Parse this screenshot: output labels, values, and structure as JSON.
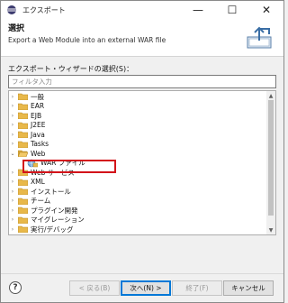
{
  "window": {
    "title": "エクスポート",
    "controls": {
      "minimize": "—",
      "maximize": "☐",
      "close": "✕"
    }
  },
  "banner": {
    "title": "選択",
    "description": "Export a Web Module into an external WAR file",
    "icon": "export-icon"
  },
  "wizard": {
    "label": "エクスポート・ウィザードの選択(S)：",
    "filter_placeholder": "フィルタ入力"
  },
  "tree": {
    "items": [
      {
        "label": "一般",
        "expanded": false
      },
      {
        "label": "EAR",
        "expanded": false
      },
      {
        "label": "EJB",
        "expanded": false
      },
      {
        "label": "J2EE",
        "expanded": false
      },
      {
        "label": "Java",
        "expanded": false
      },
      {
        "label": "Tasks",
        "expanded": false
      },
      {
        "label": "Web",
        "expanded": true
      },
      {
        "label": "WAR ファイル",
        "child": true,
        "selected": true
      },
      {
        "label": "Web サービス",
        "expanded": false
      },
      {
        "label": "XML",
        "expanded": false
      },
      {
        "label": "インストール",
        "expanded": false
      },
      {
        "label": "チーム",
        "expanded": false
      },
      {
        "label": "プラグイン開発",
        "expanded": false
      },
      {
        "label": "マイグレーション",
        "expanded": false
      },
      {
        "label": "実行/デバッグ",
        "expanded": false
      }
    ]
  },
  "buttons": {
    "help": "?",
    "back": "< 戻る(B)",
    "next": "次へ(N) >",
    "finish": "終了(F)",
    "cancel": "キャンセル"
  },
  "colors": {
    "highlight_border": "#d3141a",
    "folder": "#e8b84a",
    "default_button_border": "#0078d7"
  }
}
